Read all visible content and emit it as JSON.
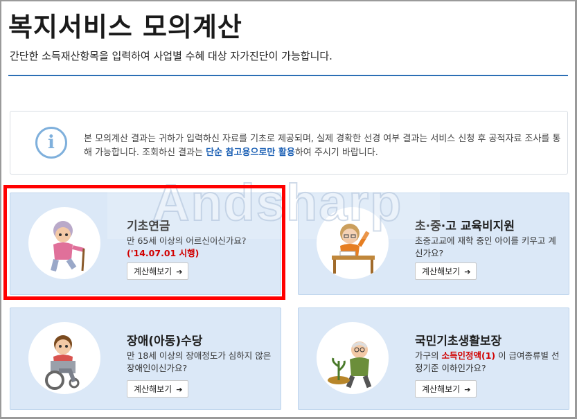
{
  "page": {
    "title": "복지서비스 모의계산",
    "subtitle": "간단한 소득재산항목을 입력하여 사업별 수혜 대상 자가진단이 가능합니다."
  },
  "notice": {
    "icon": "info-icon",
    "text_part1": "본 모의계산 결과는 귀하가 입력하신 자료를 기초로 제공되며, 실제 경확한 선경 여부 결과는 서비스 신청 후 공적자료 조사를 통해 가능합니다. 조회하신 결과는 ",
    "text_highlight": "단순 참고용으로만 활용",
    "text_part2": "하여 주시기 바랍니다.",
    "highlight_color": "#1a5fb4"
  },
  "watermark": "Andsharp",
  "cards": [
    {
      "name": "기초연금",
      "desc_line1": "만 65세 이상의 어르신이신가요?",
      "desc_red": "('14.07.01 시행)",
      "button": "계산해보기",
      "icon": "elderly-woman-icon"
    },
    {
      "name": "초·중·고 교육비지원",
      "desc_line1": "초중고교에 재학 중인 아이를 키우고 계신가요?",
      "button": "계산해보기",
      "icon": "student-icon"
    },
    {
      "name": "장애(아동)수당",
      "desc_line1": "만 18세 이상의 장애정도가 심하지 않은 장애인이신가요?",
      "button": "계산해보기",
      "icon": "wheelchair-icon"
    },
    {
      "name": "국민기초생활보장",
      "desc_pre": "가구의 ",
      "desc_red": "소득인정액(1)",
      "desc_post": " 이 급여종류별 선정기준 이하인가요?",
      "button": "계산해보기",
      "icon": "gardener-icon"
    }
  ],
  "colors": {
    "accent": "#2c6fb5",
    "card_bg": "#dbe8f7",
    "highlight_border": "#ff0000",
    "red_text": "#d10000"
  }
}
